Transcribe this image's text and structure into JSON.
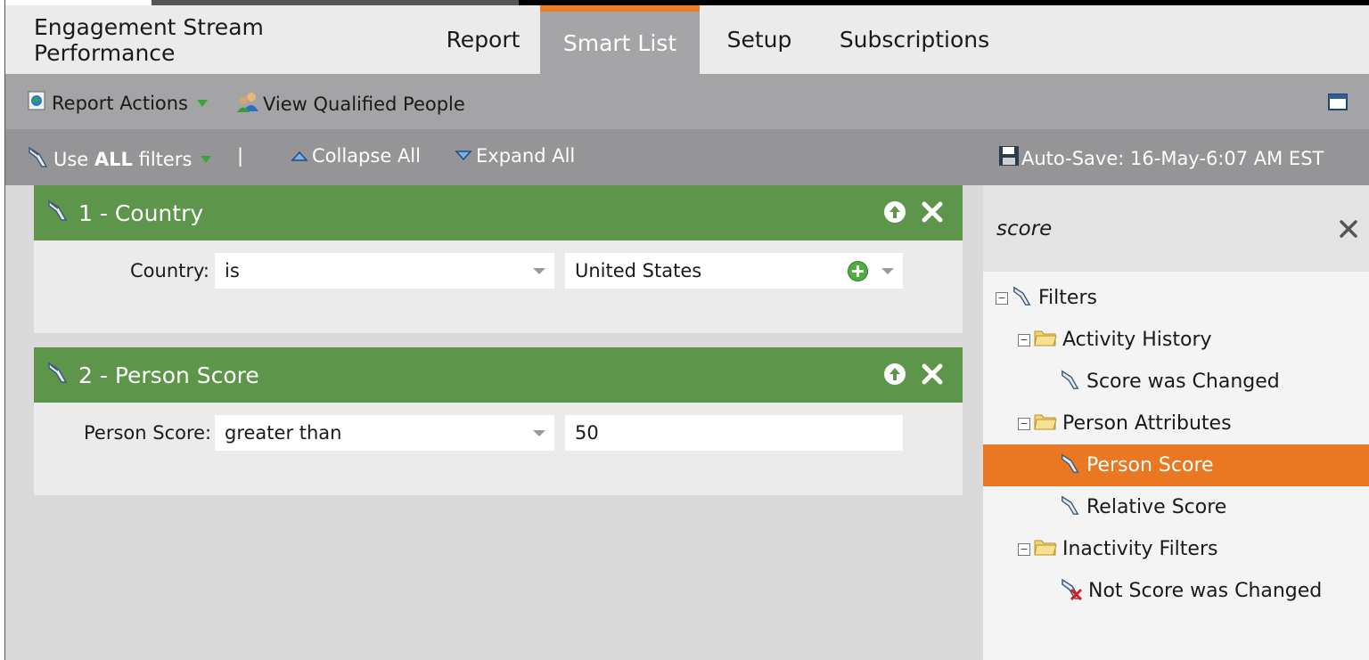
{
  "tabs": [
    {
      "label": "Engagement Stream Performance",
      "active": false
    },
    {
      "label": "Report",
      "active": false
    },
    {
      "label": "Smart List",
      "active": true
    },
    {
      "label": "Setup",
      "active": false
    },
    {
      "label": "Subscriptions",
      "active": false
    }
  ],
  "toolbar": {
    "report_actions": "Report Actions",
    "view_qualified": "View Qualified People",
    "restore_icon": "window-restore-icon"
  },
  "filterbar": {
    "use_prefix": "Use ",
    "use_bold": "ALL",
    "use_suffix": " filters",
    "separator": "|",
    "collapse_all": "Collapse All",
    "expand_all": "Expand All",
    "autosave": "Auto-Save: 16-May-6:07 AM EST"
  },
  "filters": [
    {
      "title": "1 - Country",
      "label": "Country:",
      "operator": "is",
      "value": "United States"
    },
    {
      "title": "2 - Person Score",
      "label": "Person Score:",
      "operator": "greater than",
      "value": "50"
    }
  ],
  "sidebar": {
    "search": "score",
    "tree": {
      "root": "Filters",
      "activity_history": "Activity History",
      "score_was_changed": "Score was Changed",
      "person_attributes": "Person Attributes",
      "person_score": "Person Score",
      "relative_score": "Relative Score",
      "inactivity_filters": "Inactivity Filters",
      "not_score_was_changed": "Not Score was Changed"
    }
  },
  "colors": {
    "accent_orange": "#ef7d22",
    "filter_green": "#5d954a",
    "selected_orange": "#ea7822"
  }
}
